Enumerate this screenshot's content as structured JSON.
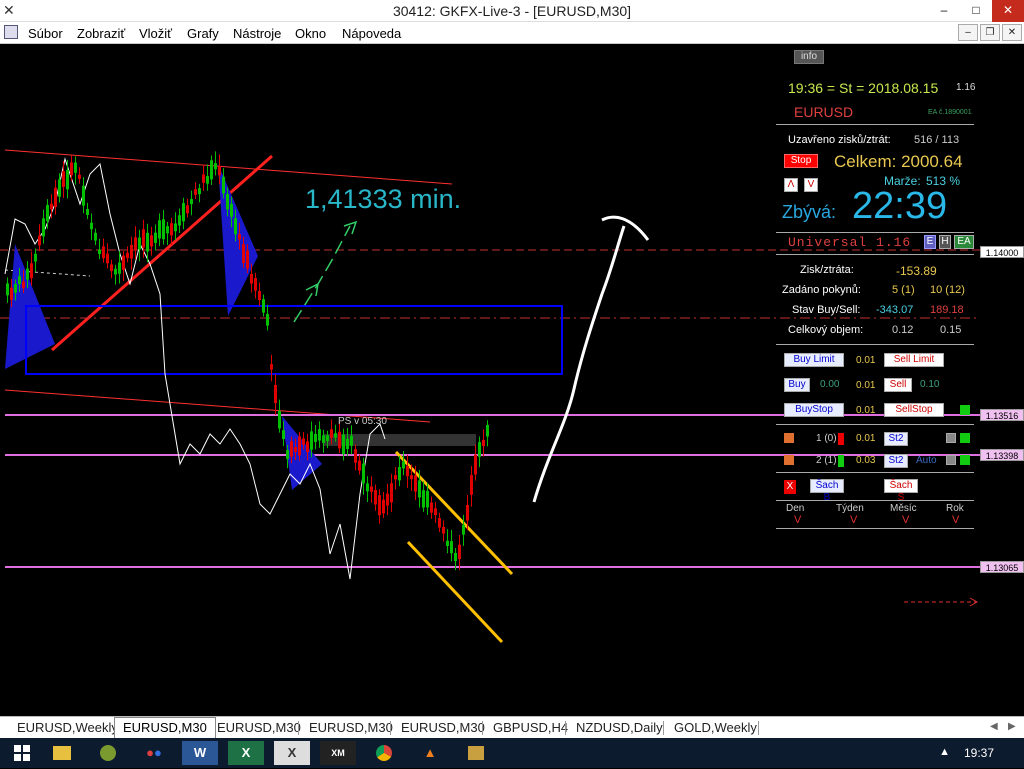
{
  "window": {
    "title": "30412: GKFX-Live-3 - [EURUSD,M30]",
    "minimize_glyph": "–",
    "maximize_glyph": "□",
    "close_glyph": "✕"
  },
  "menu": {
    "items": [
      "Súbor",
      "Zobraziť",
      "Vložiť",
      "Grafy",
      "Nástroje",
      "Okno",
      "Nápoveda"
    ],
    "mdi_minimize": "–",
    "mdi_restore": "❐",
    "mdi_close": "✕"
  },
  "chart": {
    "annotation_text": "1,41333 min.",
    "ps_label": "PS v 05:30",
    "price_labels": [
      "1.14000",
      "1.13516",
      "1.13398",
      "1.13065"
    ],
    "colors": {
      "bull": "#00c000",
      "bear": "#e00000",
      "level": "#e070e0",
      "trend_red": "#ff2020",
      "channel": "#ffc000",
      "box": "#0000ff",
      "fill": "#1a1acc",
      "cyan_text": "#29b6c8",
      "arrow_green": "#33cc66"
    }
  },
  "panel": {
    "info_label": "info",
    "datetime": "19:36 = St = 2018.08.15",
    "version_small": "1.16",
    "symbol": "EURUSD",
    "ea_id": "EA č.1890001",
    "closed_label": "Uzavřeno zisků/ztrát:",
    "closed_value": "516 / 113",
    "stop_button": "Stop",
    "total_label": "Celkem: 2000.64",
    "margin_label": "Marže:",
    "margin_value": "513 %",
    "remaining_label": "Zbývá:",
    "remaining_time": "22:39",
    "universal": "Universal 1.16",
    "badge_e": "E",
    "badge_h": "H",
    "badge_ea": "EA",
    "profit_label": "Zisk/ztráta:",
    "profit_value": "-153.89",
    "orders_label": "Zadáno pokynů:",
    "orders_buy": "5 (1)",
    "orders_sell": "10 (12)",
    "state_label": "Stav Buy/Sell:",
    "state_buy": "-343.07",
    "state_sell": "189.18",
    "volume_label": "Celkový objem:",
    "volume_buy": "0.12",
    "volume_sell": "0.15",
    "buy_limit": "Buy Limit",
    "buy_limit_lot": "0.01",
    "sell_limit": "Sell Limit",
    "buy": "Buy",
    "buy_val": "0.00",
    "mid_lot": "0.01",
    "sell": "Sell",
    "sell_val": "0.10",
    "buy_stop": "BuyStop",
    "buy_stop_lot": "0.01",
    "sell_stop": "SellStop",
    "row1_label": "1 (0)",
    "row1_lot": "0.01",
    "row1_btn": "St2",
    "row2_label": "2 (1)",
    "row2_lot": "0.03",
    "row2_btn": "St2",
    "row2_auto": "Auto",
    "close_x": "X",
    "sach_b": "Šach B",
    "sach_s": "Šach S",
    "periods": [
      "Den",
      "Týden",
      "Měsíc",
      "Rok"
    ],
    "period_mark": "V"
  },
  "tabs": [
    "EURUSD,Weekly",
    "EURUSD,M30",
    "EURUSD,M30",
    "EURUSD,M30",
    "EURUSD,M30",
    "GBPUSD,H4",
    "NZDUSD,Daily",
    "GOLD,Weekly"
  ],
  "active_tab": 1,
  "taskbar": {
    "clock": "19:37",
    "tray_arrow": "▲",
    "apps": [
      "",
      "",
      "",
      "W",
      "X",
      "X",
      "XM",
      "",
      ""
    ]
  }
}
